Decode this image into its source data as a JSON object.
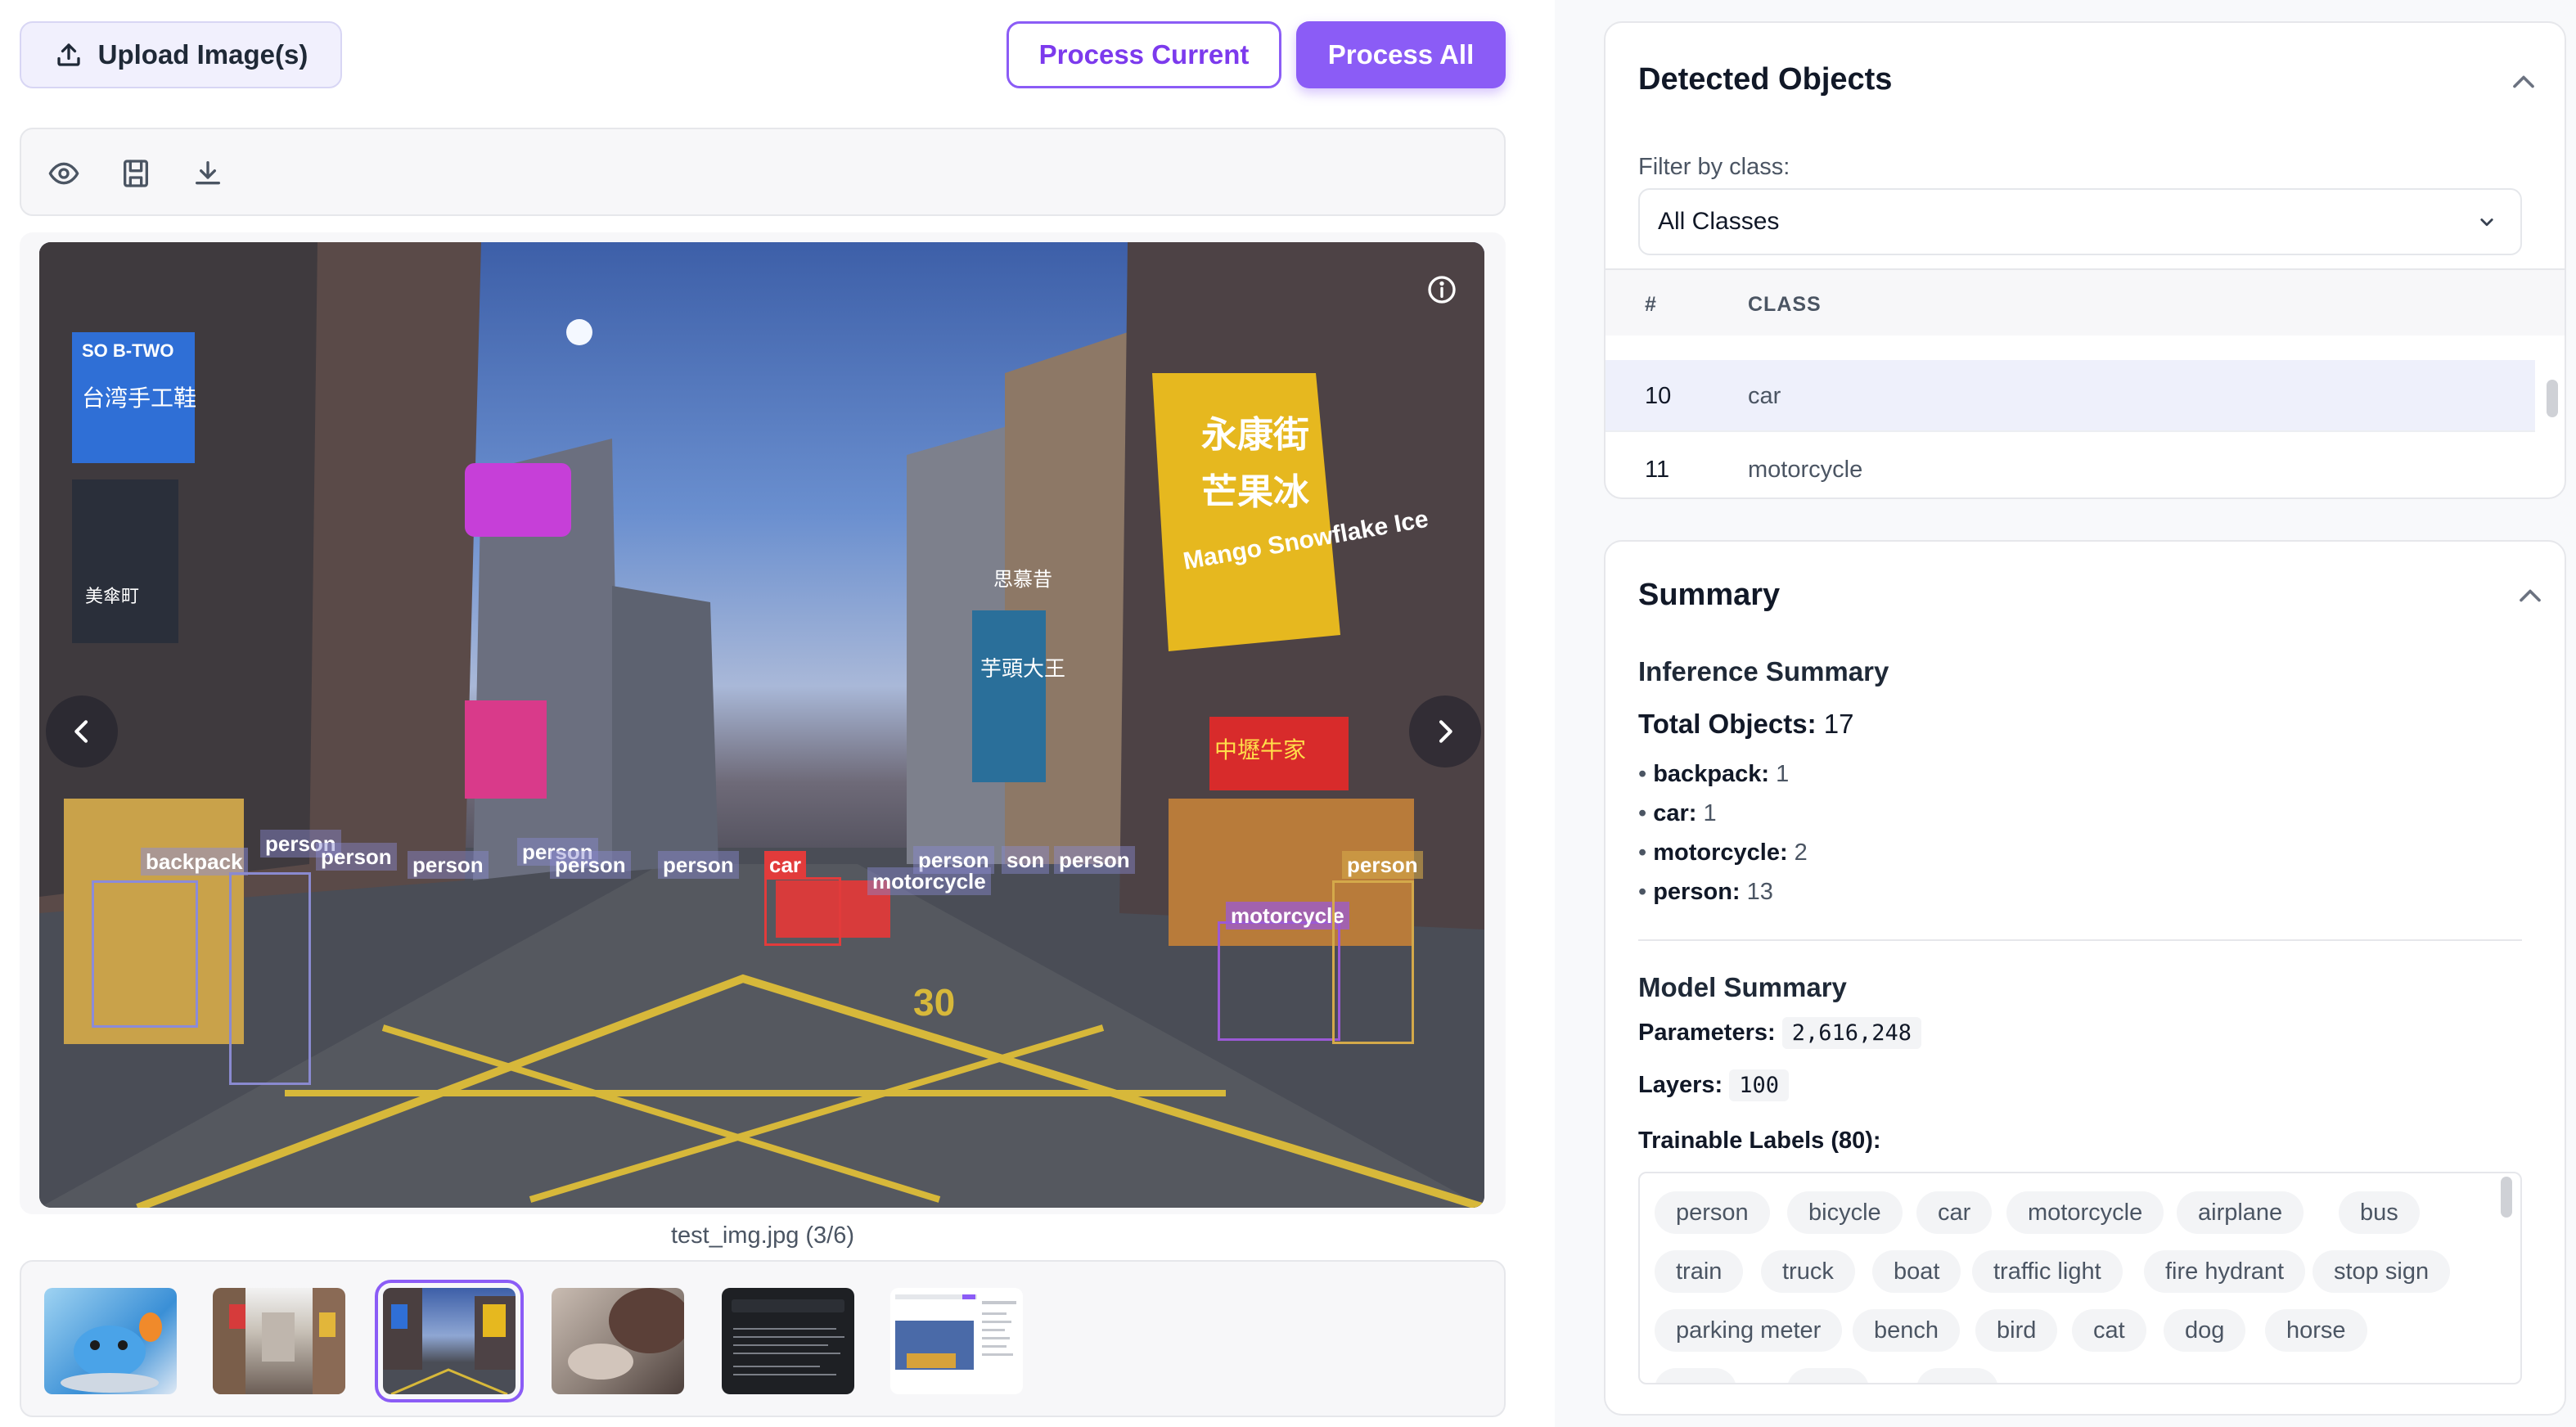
{
  "toolbar": {
    "upload_label": "Upload Image(s)",
    "process_current_label": "Process Current",
    "process_all_label": "Process All",
    "tools": [
      "eye-icon",
      "save-icon",
      "download-icon"
    ]
  },
  "viewer": {
    "caption": "test_img.jpg (3/6)",
    "detections": [
      {
        "label": "backpack",
        "color": "#8b8bd9"
      },
      {
        "label": "person",
        "color": "#8a8ad0"
      },
      {
        "label": "person",
        "color": "#8a8ad0"
      },
      {
        "label": "person",
        "color": "#8a8ad0"
      },
      {
        "label": "person",
        "color": "#8a8ad0"
      },
      {
        "label": "person",
        "color": "#8a8ad0"
      },
      {
        "label": "person",
        "color": "#8a8ad0"
      },
      {
        "label": "car",
        "color": "#e23b3b"
      },
      {
        "label": "person",
        "color": "#8a8ad0"
      },
      {
        "label": "motorcycle",
        "color": "#8a8ad0"
      },
      {
        "label": "son",
        "color": "#8a8ad0"
      },
      {
        "label": "person",
        "color": "#8a8ad0"
      },
      {
        "label": "motorcycle",
        "color": "#9b59d6"
      },
      {
        "label": "person",
        "color": "#d4a94a"
      }
    ],
    "sign_texts": {
      "sign1": "SO B-TWO",
      "sign2": "台湾手工鞋",
      "sign3": "美傘町",
      "sign4": "永康街",
      "sign5": "芒果冰",
      "sign6": "Mango Snowflake Ice",
      "sign7": "思慕昔",
      "sign8": "芋頭大王",
      "sign9": "中壢牛家",
      "sign10": "30"
    }
  },
  "detected_objects": {
    "title": "Detected Objects",
    "filter_label": "Filter by class:",
    "filter_value": "All Classes",
    "col_index": "#",
    "col_class": "CLASS",
    "rows": [
      {
        "index": "10",
        "class": "car"
      },
      {
        "index": "11",
        "class": "motorcycle"
      }
    ]
  },
  "summary": {
    "title": "Summary",
    "inference_title": "Inference Summary",
    "total_label": "Total Objects:",
    "total_value": "17",
    "counts": [
      {
        "name": "backpack:",
        "value": "1"
      },
      {
        "name": "car:",
        "value": "1"
      },
      {
        "name": "motorcycle:",
        "value": "2"
      },
      {
        "name": "person:",
        "value": "13"
      }
    ],
    "model_title": "Model Summary",
    "params_label": "Parameters:",
    "params_value": "2,616,248",
    "layers_label": "Layers:",
    "layers_value": "100",
    "labels_title": "Trainable Labels (80):",
    "labels": [
      "person",
      "bicycle",
      "car",
      "motorcycle",
      "airplane",
      "bus",
      "train",
      "truck",
      "boat",
      "traffic light",
      "fire hydrant",
      "stop sign",
      "parking meter",
      "bench",
      "bird",
      "cat",
      "dog",
      "horse"
    ]
  },
  "colors": {
    "accent": "#8b5cf6",
    "accent_dark": "#7c3aed",
    "selected_row": "#eef0fb"
  }
}
